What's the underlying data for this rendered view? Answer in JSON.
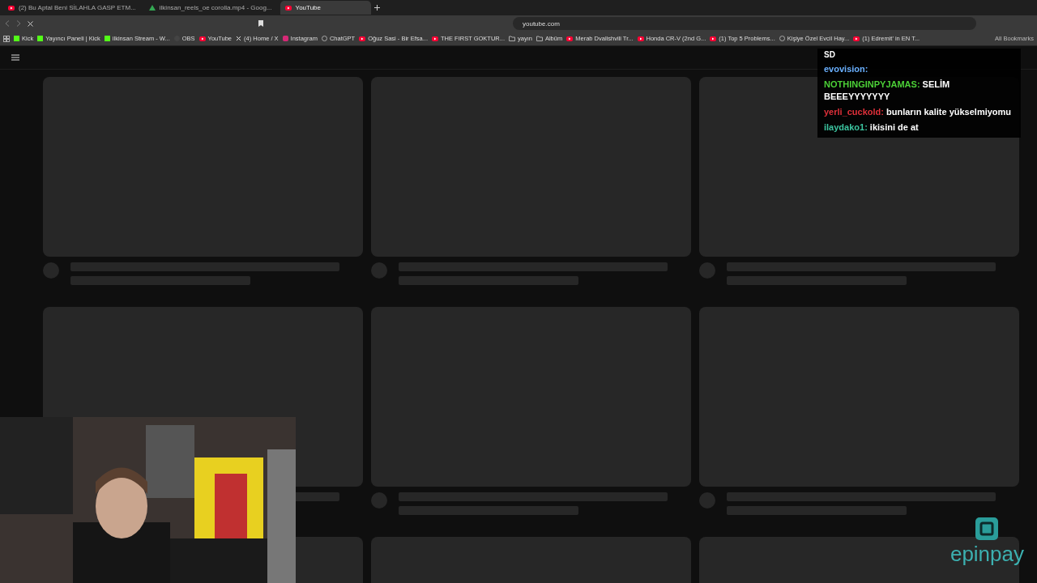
{
  "browser": {
    "tabs": [
      {
        "title": "(2) Bu Aptal Beni SİLAHLA GASP ETM...",
        "kind": "youtube",
        "selected": false
      },
      {
        "title": "ilkinsan_reels_oe corolla.mp4 - Goog...",
        "kind": "drive",
        "selected": false
      },
      {
        "title": "YouTube",
        "kind": "youtube",
        "selected": true
      }
    ],
    "address": "youtube.com",
    "bookmarks": [
      {
        "label": "Kick",
        "kind": "kick"
      },
      {
        "label": "Yayıncı Paneli | Kick",
        "kind": "kick"
      },
      {
        "label": "ilkinsan Stream - W...",
        "kind": "kick"
      },
      {
        "label": "OBS",
        "kind": "obs"
      },
      {
        "label": "YouTube",
        "kind": "youtube"
      },
      {
        "label": "(4) Home / X",
        "kind": "x"
      },
      {
        "label": "Instagram",
        "kind": "instagram"
      },
      {
        "label": "ChatGPT",
        "kind": "globe"
      },
      {
        "label": "Oğuz Sasi - Bir Efsa...",
        "kind": "youtube"
      },
      {
        "label": "THE FIRST GOKTUR...",
        "kind": "youtube"
      },
      {
        "label": "yayın",
        "kind": "folder"
      },
      {
        "label": "Albüm",
        "kind": "folder"
      },
      {
        "label": "Merab Dvalishvili Tr...",
        "kind": "youtube"
      },
      {
        "label": "Honda CR-V (2nd G...",
        "kind": "youtube"
      },
      {
        "label": "(1) Top 5 Problems...",
        "kind": "youtube"
      },
      {
        "label": "Kişiye Özel Evcil Hay...",
        "kind": "globe"
      },
      {
        "label": "(1) Edremit' in EN T...",
        "kind": "youtube"
      }
    ],
    "all_bookmarks": "All Bookmarks"
  },
  "chat": {
    "header": "SD",
    "messages": [
      {
        "user": "evovision:",
        "color": "#6ab0ff"
      },
      {
        "user": "NOTHINGINPYJAMAS:",
        "text": "SELİM BEEEYYYYYYY",
        "color": "#4cd137"
      },
      {
        "user": "yerli_cuckold:",
        "text": "bunların kalite yükselmiyomu",
        "color": "#e0303a"
      },
      {
        "user": "ilaydako1:",
        "text": "ikisini de at",
        "color": "#3cc5a0"
      }
    ]
  },
  "sponsor": {
    "name": "epinpay"
  }
}
